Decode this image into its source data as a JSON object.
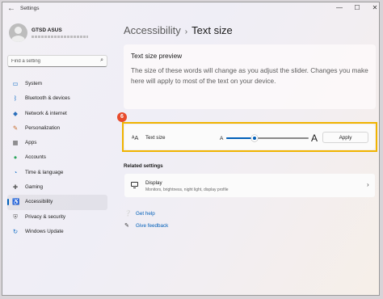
{
  "window": {
    "title": "Settings",
    "controls": {
      "minimize": "—",
      "maximize": "☐",
      "close": "✕"
    }
  },
  "user": {
    "name": "GTSD ASUS"
  },
  "search": {
    "placeholder": "Find a setting"
  },
  "sidebar": {
    "items": [
      {
        "label": "System",
        "icon": "monitor-icon",
        "color": "#1a73c8"
      },
      {
        "label": "Bluetooth & devices",
        "icon": "bluetooth-icon",
        "color": "#1a73c8"
      },
      {
        "label": "Network & internet",
        "icon": "wifi-icon",
        "color": "#2c6fbb"
      },
      {
        "label": "Personalization",
        "icon": "brush-icon",
        "color": "#c66a2c"
      },
      {
        "label": "Apps",
        "icon": "apps-icon",
        "color": "#5a5a5a"
      },
      {
        "label": "Accounts",
        "icon": "person-icon",
        "color": "#2ca55c"
      },
      {
        "label": "Time & language",
        "icon": "globe-clock-icon",
        "color": "#1a73c8"
      },
      {
        "label": "Gaming",
        "icon": "gamepad-icon",
        "color": "#5a5a5a"
      },
      {
        "label": "Accessibility",
        "icon": "accessibility-icon",
        "color": "#1a73c8",
        "active": true
      },
      {
        "label": "Privacy & security",
        "icon": "shield-icon",
        "color": "#5a5a5a"
      },
      {
        "label": "Windows Update",
        "icon": "refresh-icon",
        "color": "#1a73c8"
      }
    ]
  },
  "breadcrumb": {
    "parent": "Accessibility",
    "separator": "›",
    "current": "Text size"
  },
  "preview": {
    "title": "Text size preview",
    "text": "The size of these words will change as you adjust the slider. Changes you make here will apply to most of the text on your device."
  },
  "callout": {
    "number": "6",
    "color": "#e84b2c",
    "highlight_color": "#f0b400"
  },
  "text_size": {
    "icon": "text-size-icon",
    "label": "Text size",
    "small_label": "A",
    "large_label": "A",
    "slider_fraction": 0.34,
    "apply_label": "Apply",
    "accent": "#005fb8"
  },
  "related": {
    "heading": "Related settings",
    "display": {
      "title": "Display",
      "description": "Monitors, brightness, night light, display profile",
      "icon": "display-icon"
    }
  },
  "help": {
    "get_help": "Get help",
    "give_feedback": "Give feedback"
  }
}
